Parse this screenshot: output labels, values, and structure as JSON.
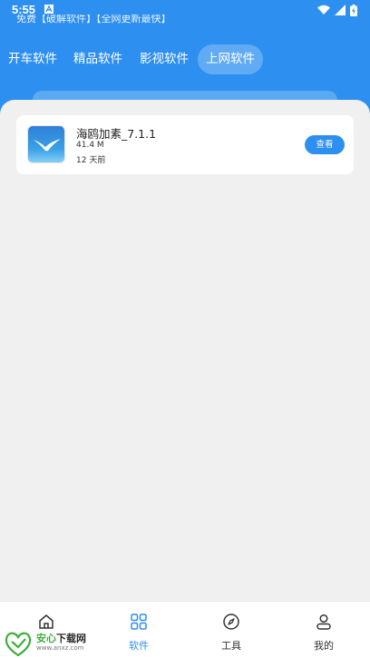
{
  "status_bar": {
    "time": "5:55"
  },
  "header": {
    "subtitle": "免费【破解软件】【全网更新最快】",
    "tabs": [
      {
        "label": "开车软件",
        "active": false
      },
      {
        "label": "精品软件",
        "active": false
      },
      {
        "label": "影视软件",
        "active": false
      },
      {
        "label": "上网软件",
        "active": true
      }
    ]
  },
  "apps": [
    {
      "name": "海鸥加素_7.1.1",
      "size": "41.4 M",
      "updated": "12 天前",
      "action_label": "查看",
      "icon": "seagull-app-icon"
    }
  ],
  "bottom_nav": [
    {
      "label": "首页",
      "icon": "home-icon",
      "active": false
    },
    {
      "label": "软件",
      "icon": "grid-icon",
      "active": true
    },
    {
      "label": "工具",
      "icon": "compass-icon",
      "active": false
    },
    {
      "label": "我的",
      "icon": "user-icon",
      "active": false
    }
  ],
  "watermark": {
    "brand_green": "安心",
    "brand_dark": "下载网",
    "url": "www.anxz.com"
  },
  "colors": {
    "accent": "#2d8ff0",
    "background": "#f0f0f0"
  }
}
